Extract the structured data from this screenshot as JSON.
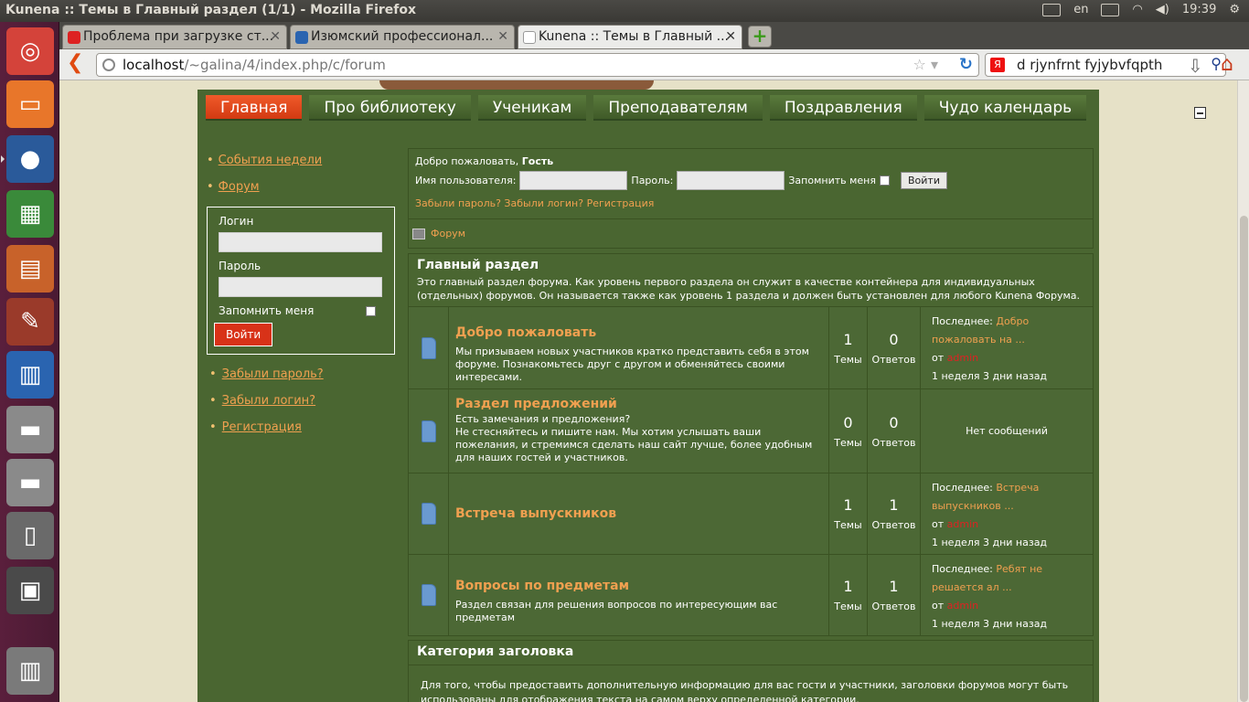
{
  "window": {
    "title": "Kunena :: Темы в Главный раздел (1/1) - Mozilla Firefox"
  },
  "tray": {
    "lang": "en",
    "time": "19:39"
  },
  "tabs": [
    {
      "label": "Проблема при загрузке ст...",
      "active": false
    },
    {
      "label": "Изюмский профессионал...",
      "active": false
    },
    {
      "label": "Kunena :: Темы в Главный ...",
      "active": true
    }
  ],
  "navbar": {
    "url_host": "localhost",
    "url_path": "/~galina/4/index.php/c/forum",
    "search_value": "d rjynfrnt fyjybvfqpth"
  },
  "menu": [
    "Главная",
    "Про библиотеку",
    "Ученикам",
    "Преподавателям",
    "Поздравления",
    "Чудо календарь"
  ],
  "left": {
    "links": [
      "События недели",
      "Форум"
    ],
    "login_label": "Логин",
    "password_label": "Пароль",
    "remember_label": "Запомнить меня",
    "login_button": "Войти",
    "bottom_links": [
      "Забыли пароль?",
      "Забыли логин?",
      "Регистрация"
    ]
  },
  "welcome": {
    "prefix": "Добро пожаловать,",
    "guest": "Гость",
    "username_label": "Имя пользователя:",
    "password_label": "Пароль:",
    "remember_label": "Запомнить меня",
    "login_button": "Войти",
    "forgot_links": "Забыли пароль? Забыли логин? Регистрация",
    "breadcrumb": "Форум"
  },
  "section": {
    "title": "Главный раздел",
    "desc": "Это главный раздел форума. Как уровень первого раздела он служит в качестве контейнера для индивидуальных (отдельных) форумов. Он называется также как уровень 1 раздела и должен быть установлен для любого Kunena Форума.",
    "topics_label": "Темы",
    "replies_label": "Ответов",
    "last_label": "Последнее:",
    "by_label": "от",
    "forums": [
      {
        "title": "Добро пожаловать",
        "desc": "Мы призываем новых участников кратко представить себя в этом форуме. Познакомьтесь друг с другом и обменяйтесь своими интересами.",
        "topics": "1",
        "replies": "0",
        "last_link": "Добро пожаловать на ...",
        "user": "admin",
        "time": "1 неделя 3 дни назад"
      },
      {
        "title": "Раздел предложений",
        "desc": "Есть замечания и предложения?\nНе стесняйтесь и пишите нам. Мы хотим услышать ваши пожелания, и стремимся сделать наш сайт лучше, более удобным для наших гостей и участников.",
        "topics": "0",
        "replies": "0",
        "no_posts": "Нет сообщений"
      },
      {
        "title": "Встреча выпускников",
        "desc": "",
        "topics": "1",
        "replies": "1",
        "last_link": "Встреча выпускников ...",
        "user": "admin",
        "time": "1 неделя 3 дни назад"
      },
      {
        "title": "Вопросы по предметам",
        "desc": "Раздел связан для решения вопросов по интересующим вас предметам",
        "topics": "1",
        "replies": "1",
        "last_link": "Ребят не решается ал ...",
        "user": "admin",
        "time": "1 неделя 3 дни назад"
      }
    ]
  },
  "category2": {
    "title": "Категория заголовка",
    "desc": "Для того, чтобы предоставить дополнительную информацию для вас гости и участники, заголовки форумов могут быть использованы для отображения текста на самом верху определенной категории."
  }
}
